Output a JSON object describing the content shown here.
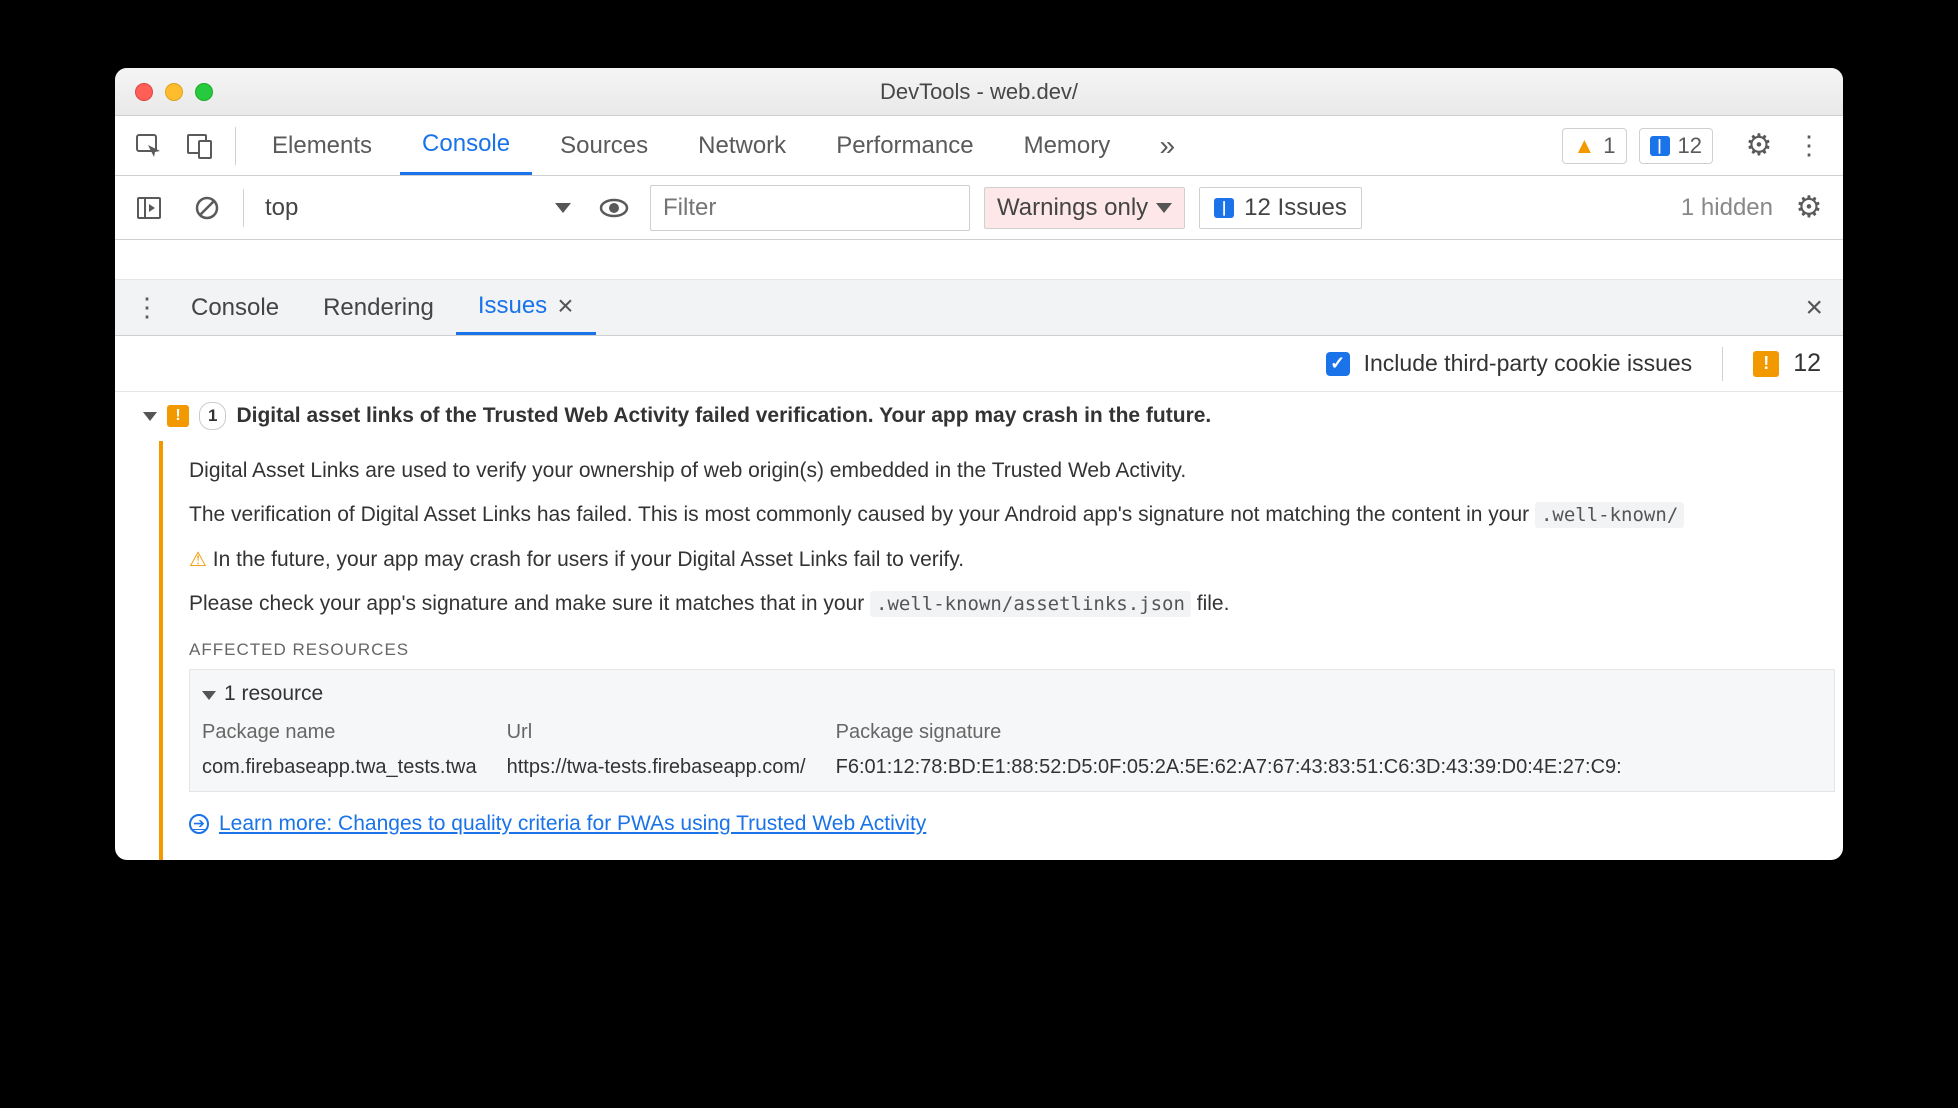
{
  "window_title": "DevTools - web.dev/",
  "main_tabs": [
    "Elements",
    "Console",
    "Sources",
    "Network",
    "Performance",
    "Memory"
  ],
  "main_active": "Console",
  "warn_count": "1",
  "issue_count": "12",
  "context": "top",
  "filter_placeholder": "Filter",
  "level_label": "Warnings only",
  "issues_btn_label": "12 Issues",
  "hidden_label": "1 hidden",
  "drawer_tabs": [
    "Console",
    "Rendering",
    "Issues"
  ],
  "drawer_active": "Issues",
  "include_label": "Include third-party cookie issues",
  "summary_count": "12",
  "issue": {
    "count_pill": "1",
    "title": "Digital asset links of the Trusted Web Activity failed verification. Your app may crash in the future.",
    "p1": "Digital Asset Links are used to verify your ownership of web origin(s) embedded in the Trusted Web Activity.",
    "p2_pre": "The verification of Digital Asset Links has failed. This is most commonly caused by your Android app's signature not matching the content in your ",
    "p2_code": ".well-known/",
    "p3": "In the future, your app may crash for users if your Digital Asset Links fail to verify.",
    "p4_pre": "Please check your app's signature and make sure it matches that in your ",
    "p4_code": ".well-known/assetlinks.json",
    "p4_post": " file.",
    "affected_heading": "Affected Resources",
    "res_count": "1 resource",
    "cols": {
      "pkg": "Package name",
      "url": "Url",
      "sig": "Package signature"
    },
    "row": {
      "pkg": "com.firebaseapp.twa_tests.twa",
      "url": "https://twa-tests.firebaseapp.com/",
      "sig": "F6:01:12:78:BD:E1:88:52:D5:0F:05:2A:5E:62:A7:67:43:83:51:C6:3D:43:39:D0:4E:27:C9:"
    },
    "learn_more": "Learn more: Changes to quality criteria for PWAs using Trusted Web Activity"
  }
}
